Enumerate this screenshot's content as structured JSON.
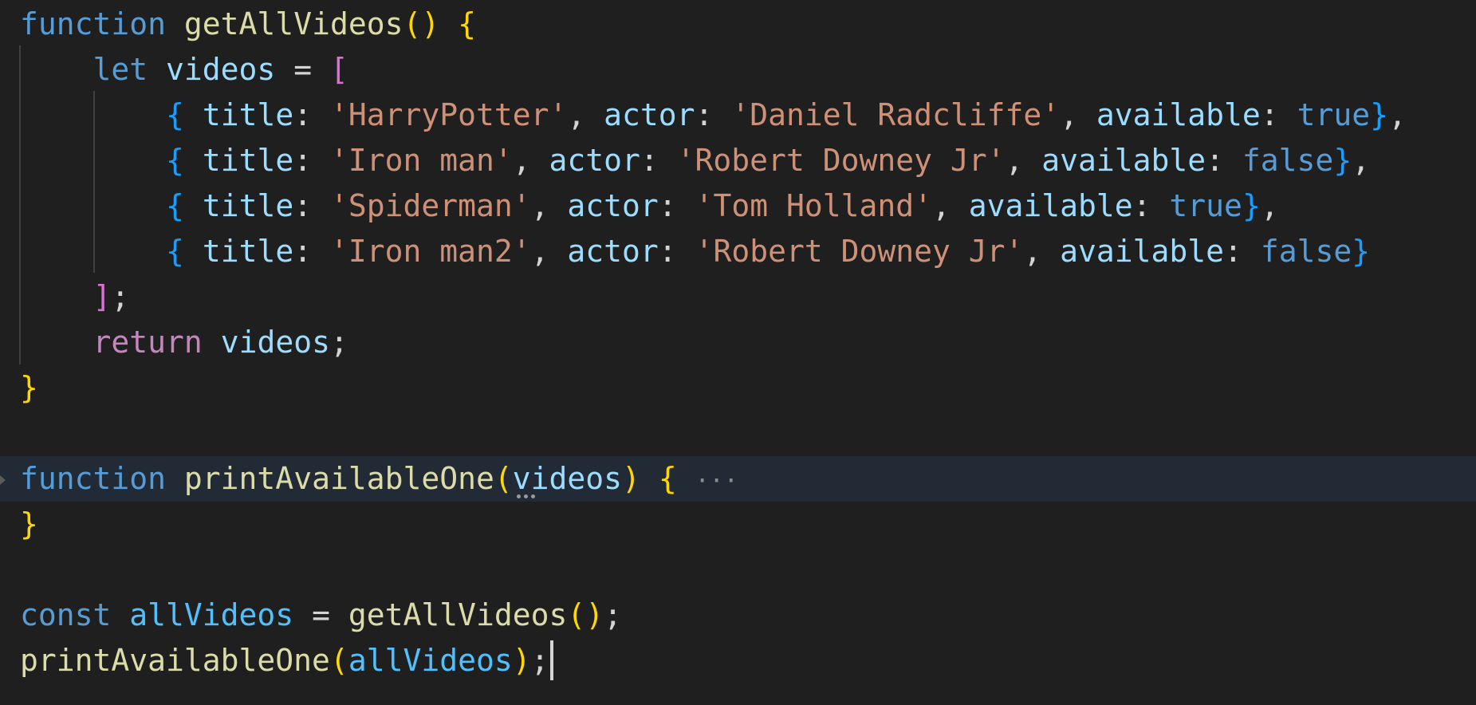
{
  "editor": {
    "lines": [
      {
        "tokens": [
          {
            "t": "function",
            "c": "kw"
          },
          {
            "t": " ",
            "c": "punc"
          },
          {
            "t": "getAllVideos",
            "c": "fn"
          },
          {
            "t": "()",
            "c": "br1"
          },
          {
            "t": " ",
            "c": "punc"
          },
          {
            "t": "{",
            "c": "br1"
          }
        ]
      },
      {
        "tokens": [
          {
            "t": "    ",
            "c": "punc"
          },
          {
            "t": "let",
            "c": "kw"
          },
          {
            "t": " ",
            "c": "punc"
          },
          {
            "t": "videos",
            "c": "var"
          },
          {
            "t": " = ",
            "c": "punc"
          },
          {
            "t": "[",
            "c": "br2"
          }
        ]
      },
      {
        "tokens": [
          {
            "t": "        ",
            "c": "punc"
          },
          {
            "t": "{",
            "c": "br3"
          },
          {
            "t": " ",
            "c": "punc"
          },
          {
            "t": "title",
            "c": "var"
          },
          {
            "t": ": ",
            "c": "punc"
          },
          {
            "t": "'HarryPotter'",
            "c": "str"
          },
          {
            "t": ", ",
            "c": "punc"
          },
          {
            "t": "actor",
            "c": "var"
          },
          {
            "t": ": ",
            "c": "punc"
          },
          {
            "t": "'Daniel Radcliffe'",
            "c": "str"
          },
          {
            "t": ", ",
            "c": "punc"
          },
          {
            "t": "available",
            "c": "var"
          },
          {
            "t": ": ",
            "c": "punc"
          },
          {
            "t": "true",
            "c": "bool"
          },
          {
            "t": "}",
            "c": "br3"
          },
          {
            "t": ",",
            "c": "punc"
          }
        ]
      },
      {
        "tokens": [
          {
            "t": "        ",
            "c": "punc"
          },
          {
            "t": "{",
            "c": "br3"
          },
          {
            "t": " ",
            "c": "punc"
          },
          {
            "t": "title",
            "c": "var"
          },
          {
            "t": ": ",
            "c": "punc"
          },
          {
            "t": "'Iron man'",
            "c": "str"
          },
          {
            "t": ", ",
            "c": "punc"
          },
          {
            "t": "actor",
            "c": "var"
          },
          {
            "t": ": ",
            "c": "punc"
          },
          {
            "t": "'Robert Downey Jr'",
            "c": "str"
          },
          {
            "t": ", ",
            "c": "punc"
          },
          {
            "t": "available",
            "c": "var"
          },
          {
            "t": ": ",
            "c": "punc"
          },
          {
            "t": "false",
            "c": "bool"
          },
          {
            "t": "}",
            "c": "br3"
          },
          {
            "t": ",",
            "c": "punc"
          }
        ]
      },
      {
        "tokens": [
          {
            "t": "        ",
            "c": "punc"
          },
          {
            "t": "{",
            "c": "br3"
          },
          {
            "t": " ",
            "c": "punc"
          },
          {
            "t": "title",
            "c": "var"
          },
          {
            "t": ": ",
            "c": "punc"
          },
          {
            "t": "'Spiderman'",
            "c": "str"
          },
          {
            "t": ", ",
            "c": "punc"
          },
          {
            "t": "actor",
            "c": "var"
          },
          {
            "t": ": ",
            "c": "punc"
          },
          {
            "t": "'Tom Holland'",
            "c": "str"
          },
          {
            "t": ", ",
            "c": "punc"
          },
          {
            "t": "available",
            "c": "var"
          },
          {
            "t": ": ",
            "c": "punc"
          },
          {
            "t": "true",
            "c": "bool"
          },
          {
            "t": "}",
            "c": "br3"
          },
          {
            "t": ",",
            "c": "punc"
          }
        ]
      },
      {
        "tokens": [
          {
            "t": "        ",
            "c": "punc"
          },
          {
            "t": "{",
            "c": "br3"
          },
          {
            "t": " ",
            "c": "punc"
          },
          {
            "t": "title",
            "c": "var"
          },
          {
            "t": ": ",
            "c": "punc"
          },
          {
            "t": "'Iron man2'",
            "c": "str"
          },
          {
            "t": ", ",
            "c": "punc"
          },
          {
            "t": "actor",
            "c": "var"
          },
          {
            "t": ": ",
            "c": "punc"
          },
          {
            "t": "'Robert Downey Jr'",
            "c": "str"
          },
          {
            "t": ", ",
            "c": "punc"
          },
          {
            "t": "available",
            "c": "var"
          },
          {
            "t": ": ",
            "c": "punc"
          },
          {
            "t": "false",
            "c": "bool"
          },
          {
            "t": "}",
            "c": "br3"
          }
        ]
      },
      {
        "tokens": [
          {
            "t": "    ",
            "c": "punc"
          },
          {
            "t": "]",
            "c": "br2"
          },
          {
            "t": ";",
            "c": "punc"
          }
        ]
      },
      {
        "tokens": [
          {
            "t": "    ",
            "c": "punc"
          },
          {
            "t": "return",
            "c": "ctrl"
          },
          {
            "t": " ",
            "c": "punc"
          },
          {
            "t": "videos",
            "c": "var"
          },
          {
            "t": ";",
            "c": "punc"
          }
        ]
      },
      {
        "tokens": [
          {
            "t": "}",
            "c": "br1"
          }
        ]
      },
      {
        "tokens": []
      },
      {
        "tokens": [
          {
            "t": "function",
            "c": "kw"
          },
          {
            "t": " ",
            "c": "punc"
          },
          {
            "t": "printAvailableOne",
            "c": "fn"
          },
          {
            "t": "(",
            "c": "br1"
          },
          {
            "t": "videos",
            "c": "var"
          },
          {
            "t": ")",
            "c": "br1"
          },
          {
            "t": " ",
            "c": "punc"
          },
          {
            "t": "{",
            "c": "br1"
          },
          {
            "t": " ",
            "c": "punc"
          },
          {
            "t": "···",
            "c": "ellipsis"
          }
        ]
      },
      {
        "tokens": [
          {
            "t": "}",
            "c": "br1"
          }
        ]
      },
      {
        "tokens": []
      },
      {
        "tokens": [
          {
            "t": "const",
            "c": "kw"
          },
          {
            "t": " ",
            "c": "punc"
          },
          {
            "t": "allVideos",
            "c": "const"
          },
          {
            "t": " = ",
            "c": "punc"
          },
          {
            "t": "getAllVideos",
            "c": "fn"
          },
          {
            "t": "()",
            "c": "br1"
          },
          {
            "t": ";",
            "c": "punc"
          }
        ]
      },
      {
        "tokens": [
          {
            "t": "printAvailableOne",
            "c": "fn"
          },
          {
            "t": "(",
            "c": "br1"
          },
          {
            "t": "allVideos",
            "c": "const"
          },
          {
            "t": ")",
            "c": "br1"
          },
          {
            "t": ";",
            "c": "punc"
          }
        ]
      }
    ]
  },
  "colors": {
    "background": "#1f1f1f",
    "keyword": "#569cd6",
    "control": "#c586c0",
    "function": "#dcdcaa",
    "variable": "#9cdcfe",
    "constant": "#4fc1ff",
    "string": "#ce9178",
    "bracket_level1": "#ffd700",
    "bracket_level2": "#da70d6",
    "bracket_level3": "#179fff"
  }
}
